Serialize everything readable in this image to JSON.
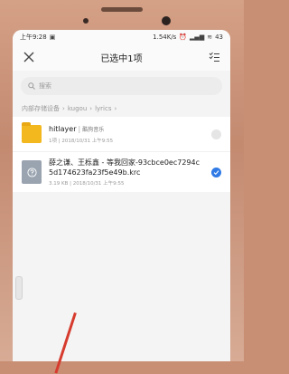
{
  "status": {
    "time": "上午9:28",
    "network": "1.54K/s",
    "battery": "43"
  },
  "header": {
    "title": "已选中1项"
  },
  "search": {
    "placeholder": "搜索"
  },
  "breadcrumb": {
    "items": [
      "内部存储设备",
      "kugou",
      "lyrics"
    ]
  },
  "files": [
    {
      "name": "hitlayer",
      "tag": "酷狗音乐",
      "meta": "1项 | 2018/10/31 上午9:55",
      "type": "folder",
      "selected": false
    },
    {
      "name": "薛之谦、王栎鑫 - 等我回家-93cbce0ec7294c5d174623fa23f5e49b.krc",
      "meta": "3.19 KB | 2018/10/31 上午9:55",
      "type": "file",
      "selected": true
    }
  ],
  "colors": {
    "accent": "#2f7ae5",
    "folder": "#f2b81e",
    "frame": "#c98f74"
  }
}
